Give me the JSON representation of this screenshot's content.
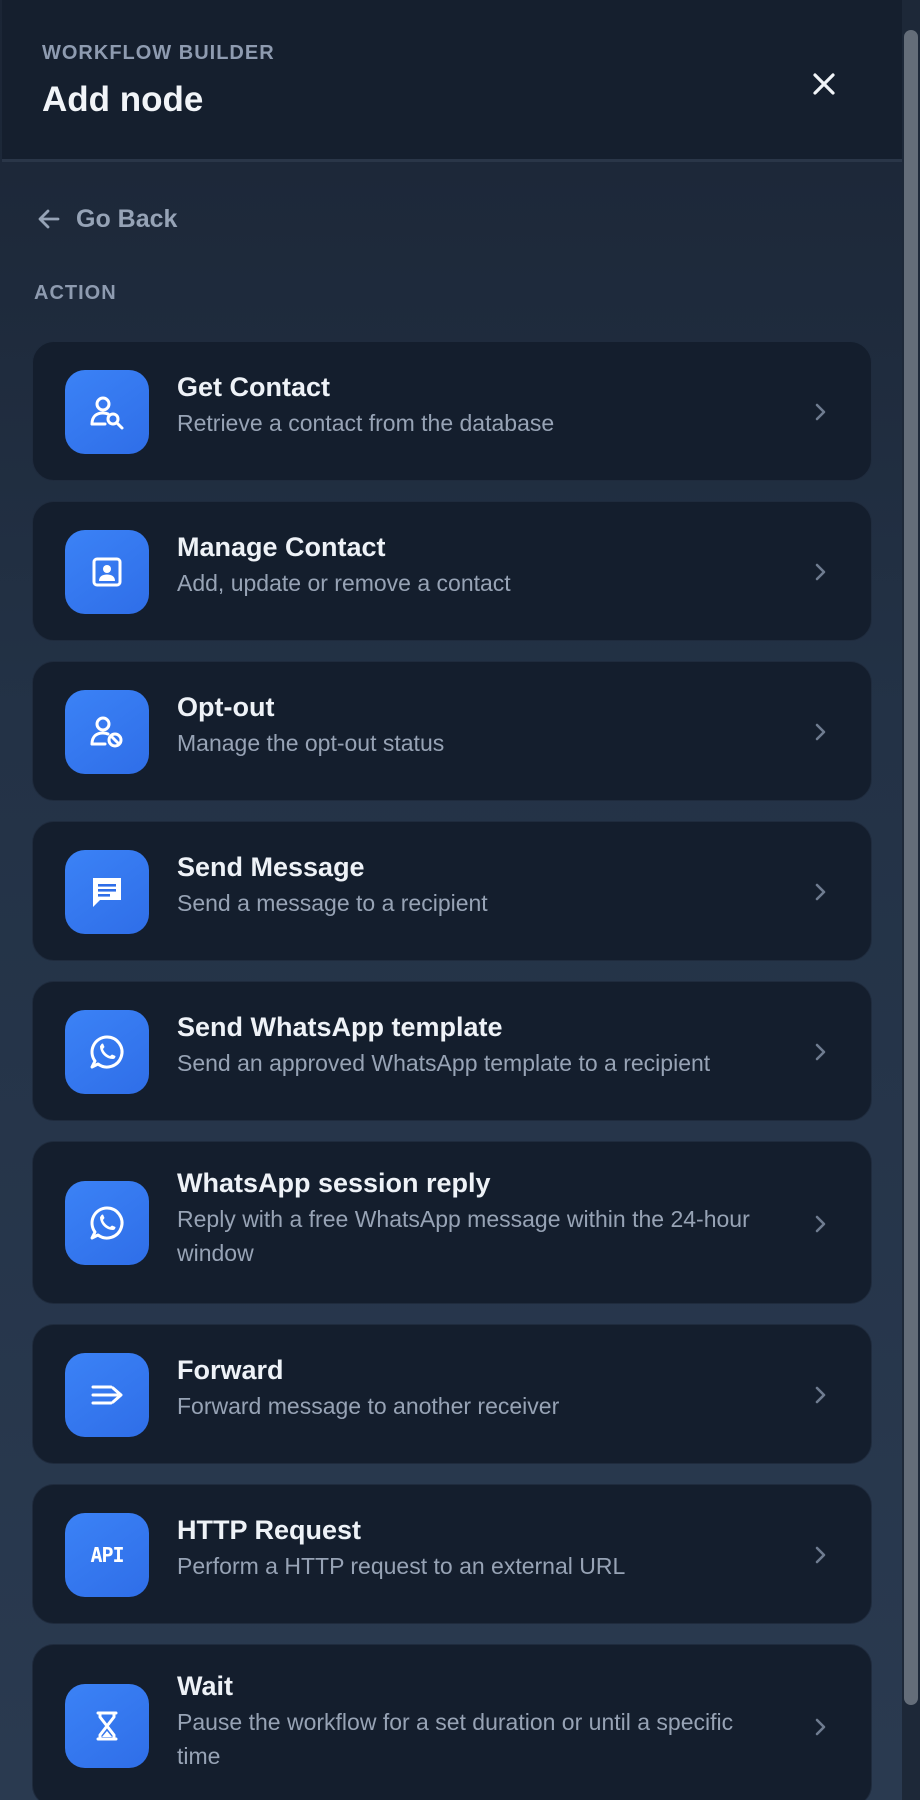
{
  "header": {
    "eyebrow": "WORKFLOW BUILDER",
    "title": "Add node",
    "close_icon": "close-icon"
  },
  "back": {
    "label": "Go Back",
    "icon": "arrow-left-icon"
  },
  "section": {
    "label": "ACTION"
  },
  "accent_colors": {
    "tile": "#3b82f6",
    "card_bg": "#141e2d",
    "header_bg": "#151f2e"
  },
  "items": [
    {
      "title": "Get Contact",
      "description": "Retrieve a contact from the database",
      "icon": "user-search-icon"
    },
    {
      "title": "Manage Contact",
      "description": "Add, update or remove a contact",
      "icon": "contact-card-icon"
    },
    {
      "title": "Opt-out",
      "description": "Manage the opt-out status",
      "icon": "user-block-icon"
    },
    {
      "title": "Send Message",
      "description": "Send a message to a recipient",
      "icon": "message-icon"
    },
    {
      "title": "Send WhatsApp template",
      "description": "Send an approved WhatsApp template to a recipient",
      "icon": "whatsapp-icon"
    },
    {
      "title": "WhatsApp session reply",
      "description": "Reply with a free WhatsApp message within the 24-hour window",
      "icon": "whatsapp-icon"
    },
    {
      "title": "Forward",
      "description": "Forward message to another receiver",
      "icon": "forward-icon"
    },
    {
      "title": "HTTP Request",
      "description": "Perform a HTTP request to an external URL",
      "icon": "api-icon",
      "icon_text": "API"
    },
    {
      "title": "Wait",
      "description": "Pause the workflow for a set duration or until a specific time",
      "icon": "hourglass-icon"
    }
  ]
}
